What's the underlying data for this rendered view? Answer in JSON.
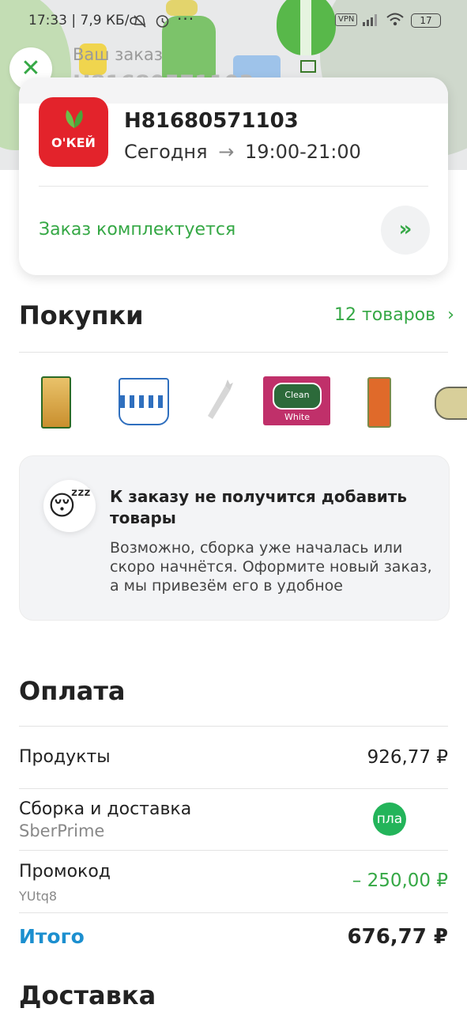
{
  "status_bar": {
    "time_speed": "17:33 | 7,9 КБ/с",
    "dots": "···",
    "vpn": "VPN",
    "battery": "17",
    "icons": [
      "mute-icon",
      "alarm-icon",
      "signal-icon",
      "wifi-icon",
      "battery-icon"
    ]
  },
  "header": {
    "subtitle": "Ваш заказ",
    "order_number": "H81680571103",
    "close_icon": "✕"
  },
  "order_card": {
    "store_logo_text": "О'КЕЙ",
    "order_id": "H81680571103",
    "day": "Сегодня",
    "arrow": "→",
    "slot": "19:00-21:00",
    "status": "Заказ комплектуется",
    "go_icon": "»"
  },
  "purchases": {
    "title": "Покупки",
    "count_link": "12 товаров",
    "chevron": "›",
    "thumbnails": [
      "pasta",
      "sour-cream",
      "carrot",
      "soap",
      "fish",
      "canned-fish"
    ],
    "soap_label": "Clean White"
  },
  "notice": {
    "emoji": "😴",
    "title": "К заказу не получится добавить товары",
    "body": "Возможно, сборка уже началась или скоро начнётся. Оформите новый заказ, а мы привезём его в удобное"
  },
  "payment": {
    "title": "Оплата",
    "products_label": "Продукты",
    "products_value": "926,77 ₽",
    "delivery_label": "Сборка и доставка",
    "delivery_sub": "SberPrime",
    "delivery_badge": "пла",
    "promo_label": "Промокод",
    "promo_code": "YUtq8",
    "promo_value": "–  250,00 ₽",
    "total_label": "Итого",
    "total_value": "676,77 ₽"
  },
  "delivery": {
    "title": "Доставка"
  },
  "colors": {
    "green": "#35a845",
    "brand_red": "#e3232b",
    "total_blue": "#1c8fcf"
  }
}
